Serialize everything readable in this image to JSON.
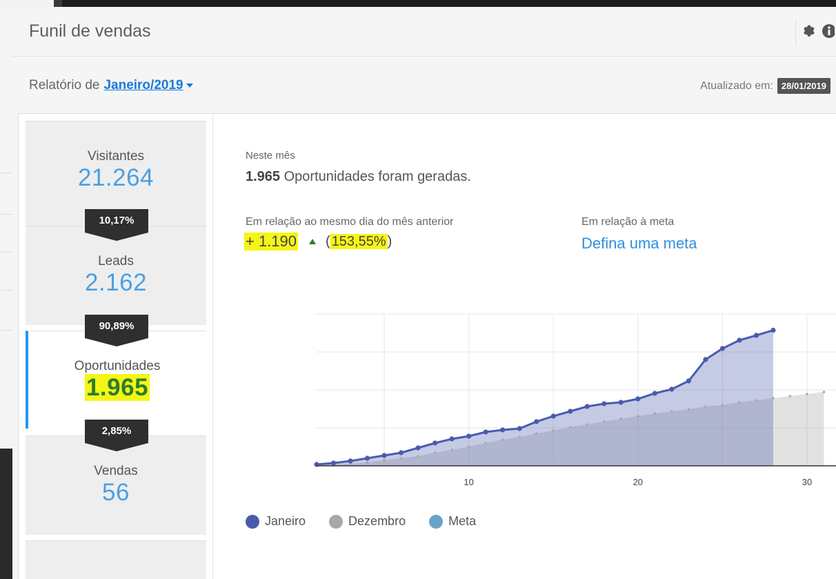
{
  "widget": {
    "title": "Funil de vendas",
    "icons": [
      "gear-icon",
      "info-icon"
    ]
  },
  "report": {
    "prefix": "Relatório de",
    "month": "Janeiro/2019",
    "updated_label": "Atualizado em:",
    "updated_date": "28/01/2019"
  },
  "funnel": {
    "stages": [
      {
        "label": "Visitantes",
        "value": "21.264"
      },
      {
        "label": "Leads",
        "value": "2.162"
      },
      {
        "label": "Oportunidades",
        "value": "1.965"
      },
      {
        "label": "Vendas",
        "value": "56"
      }
    ],
    "rates": [
      "10,17%",
      "90,89%",
      "2,85%"
    ]
  },
  "summary": {
    "period_label": "Neste mês",
    "count": "1.965",
    "count_text": "Oportunidades foram geradas.",
    "comparison_label": "Em relação ao mesmo dia do mês anterior",
    "comparison_value": "+ 1.190",
    "comparison_pct_open": "(",
    "comparison_pct": "153,55%",
    "comparison_pct_close": ")",
    "goal_label": "Em relação à meta",
    "goal_link": "Defina uma meta"
  },
  "chart_data": {
    "type": "area",
    "x_ticks": [
      10,
      20,
      30
    ],
    "xlim": [
      1,
      32
    ],
    "ylim": [
      0,
      2200
    ],
    "grid": true,
    "legend_position": "bottom-left",
    "series": [
      {
        "name": "Janeiro",
        "color": "#4a5bad",
        "x": [
          1,
          2,
          3,
          4,
          5,
          6,
          7,
          8,
          9,
          10,
          11,
          12,
          13,
          14,
          15,
          16,
          17,
          18,
          19,
          20,
          21,
          22,
          23,
          24,
          25,
          26,
          27,
          28
        ],
        "values": [
          20,
          40,
          70,
          110,
          150,
          190,
          260,
          330,
          390,
          430,
          490,
          520,
          540,
          640,
          720,
          790,
          860,
          900,
          920,
          970,
          1050,
          1110,
          1230,
          1540,
          1700,
          1820,
          1890,
          1965
        ]
      },
      {
        "name": "Dezembro",
        "color": "#a8a8a8",
        "x": [
          1,
          2,
          3,
          4,
          5,
          6,
          7,
          8,
          9,
          10,
          11,
          12,
          13,
          14,
          15,
          16,
          17,
          18,
          19,
          20,
          21,
          22,
          23,
          24,
          25,
          26,
          27,
          28,
          29,
          30,
          31
        ],
        "values": [
          10,
          20,
          30,
          50,
          80,
          110,
          140,
          190,
          230,
          280,
          330,
          380,
          420,
          470,
          510,
          560,
          600,
          640,
          680,
          720,
          760,
          790,
          820,
          860,
          880,
          920,
          950,
          980,
          1010,
          1040,
          1070
        ]
      }
    ],
    "legend": [
      "Janeiro",
      "Dezembro",
      "Meta"
    ],
    "legend_colors": [
      "#4a5bad",
      "#a8a8a8",
      "#6aa3c8"
    ]
  }
}
